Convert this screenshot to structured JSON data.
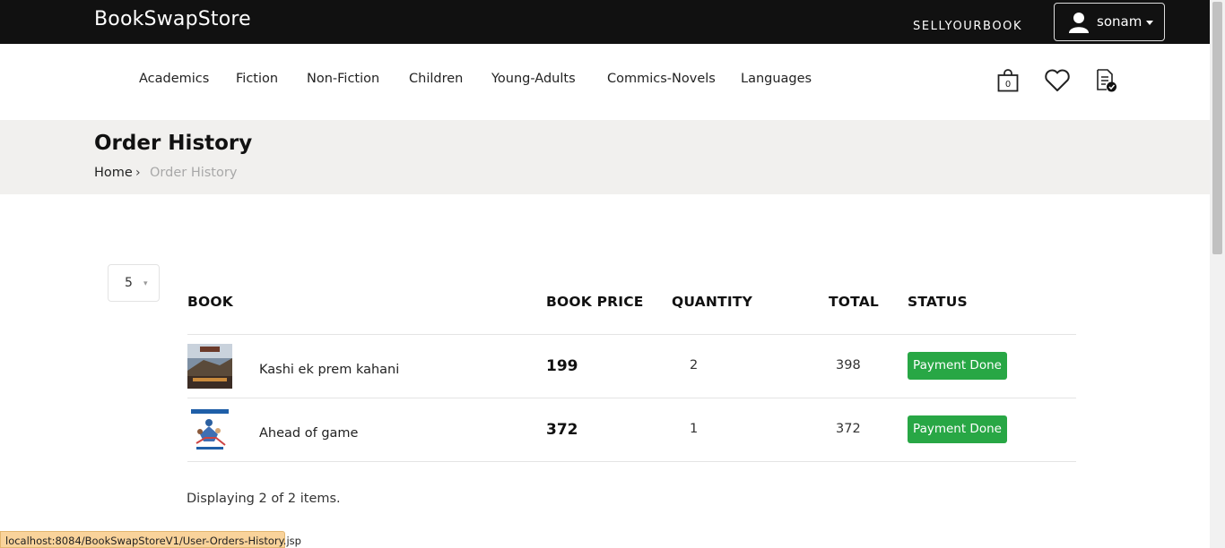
{
  "header": {
    "brand": "BookSwapStore",
    "sell_link": "SELLYOURBOOK",
    "user_name": "sonam"
  },
  "nav": {
    "items": [
      "Academics",
      "Fiction",
      "Non-Fiction",
      "Children",
      "Young-Adults",
      "Commics-Novels",
      "Languages"
    ],
    "cart_count": "0",
    "icons": [
      "cart-icon",
      "heart-icon",
      "order-list-icon"
    ]
  },
  "page": {
    "title": "Order History",
    "breadcrumb_home": "Home",
    "breadcrumb_separator": "›",
    "breadcrumb_current": "Order History"
  },
  "table": {
    "page_size": "5",
    "columns": [
      "BOOK",
      "BOOK PRICE",
      "QUANTITY",
      "TOTAL",
      "STATUS"
    ],
    "rows": [
      {
        "title": "Kashi ek prem kahani",
        "price": "199",
        "quantity": "2",
        "total": "398",
        "status": "Payment Done"
      },
      {
        "title": "Ahead of game",
        "price": "372",
        "quantity": "1",
        "total": "372",
        "status": "Payment Done"
      }
    ],
    "summary": "Displaying 2 of 2 items."
  },
  "statusbar": {
    "url": "localhost:8084/BookSwapStoreV1/User-Orders-History.jsp"
  },
  "colors": {
    "topbar": "#111111",
    "page_header_bg": "#f1f0ee",
    "status_green": "#28a745"
  }
}
